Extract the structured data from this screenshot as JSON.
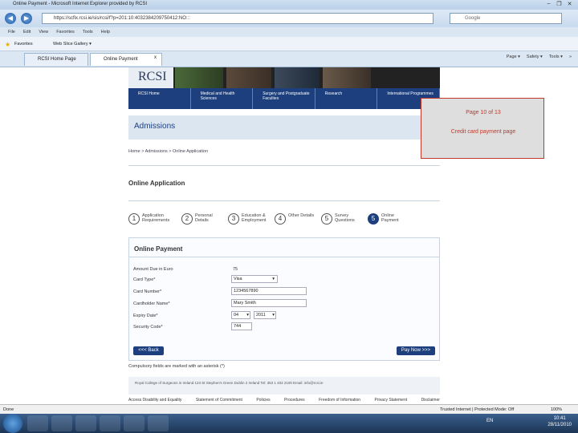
{
  "window": {
    "title": "Online Payment - Microsoft Internet Explorer provided by RCSI",
    "minimize": "–",
    "maximize": "❐",
    "close": "✕"
  },
  "browser": {
    "back": "◀",
    "forward": "▶",
    "address": "https://scfix.rcsi.ie/sis/rcsi/f?p=201:10:4032384209750412:NO:::",
    "search_placeholder": "Google",
    "menu": [
      "File",
      "Edit",
      "View",
      "Favorites",
      "Tools",
      "Help"
    ],
    "favorites_label": "Favorites",
    "web_slice": "Web Slice Gallery ▾",
    "tabs": [
      {
        "label": "RCSI Home Page"
      },
      {
        "label": "Online Payment"
      }
    ],
    "tab_close": "x",
    "commands": [
      "Page ▾",
      "Safety ▾",
      "Tools ▾",
      "»"
    ]
  },
  "site": {
    "logo": "RCSI",
    "nav": [
      "RCSI Home",
      "Medical and Health Sciences",
      "Surgery and Postgraduate Faculties",
      "Research",
      "International Programmes"
    ],
    "section_title": "Admissions",
    "breadcrumb": "Home > Admissions > Online Application",
    "app_title": "Online Application",
    "steps": [
      {
        "num": "1",
        "label": "Application Requirements"
      },
      {
        "num": "2",
        "label": "Personal Details"
      },
      {
        "num": "3",
        "label": "Education & Employment"
      },
      {
        "num": "4",
        "label": "Other Details"
      },
      {
        "num": "5",
        "label": "Survey Questions"
      },
      {
        "num": "5",
        "label": "Online Payment"
      }
    ],
    "payment": {
      "title": "Online Payment",
      "amount_label": "Amount Due in Euro",
      "amount_value": "75",
      "card_type_label": "Card Type*",
      "card_type_value": "Visa",
      "card_number_label": "Card Number*",
      "card_number_value": "1234567890",
      "holder_label": "Cardholder Name*",
      "holder_value": "Mary Smith",
      "expiry_label": "Expiry Date*",
      "expiry_month": "04",
      "expiry_year": "2011",
      "security_label": "Security Code*",
      "security_value": "744",
      "back_button": "<<< Back",
      "pay_button": "Pay Now >>>"
    },
    "compulsory_note": "Compulsory fields are marked with an asterisk (*)",
    "footer": "Royal College of Surgeons in Ireland  123 St Stephen's Green  Dublin 2  Ireland  Tel: 353 1 402 2100  Email: info@rcsi.ie",
    "footer_links": [
      "Access Disability and Equality",
      "Statement of Commitment",
      "Policies",
      "Procedures",
      "Freedom of Information",
      "Privacy Statement",
      "Disclaimer"
    ]
  },
  "annotation": {
    "line1": "Page 10 of 13",
    "line2": "Credit card payment page"
  },
  "status": {
    "left": "Done",
    "zone": "Trusted Internet | Protected Mode: Off",
    "zoom": "100%"
  },
  "taskbar": {
    "lang": "EN",
    "time": "10:41",
    "date": "28/11/2010"
  }
}
